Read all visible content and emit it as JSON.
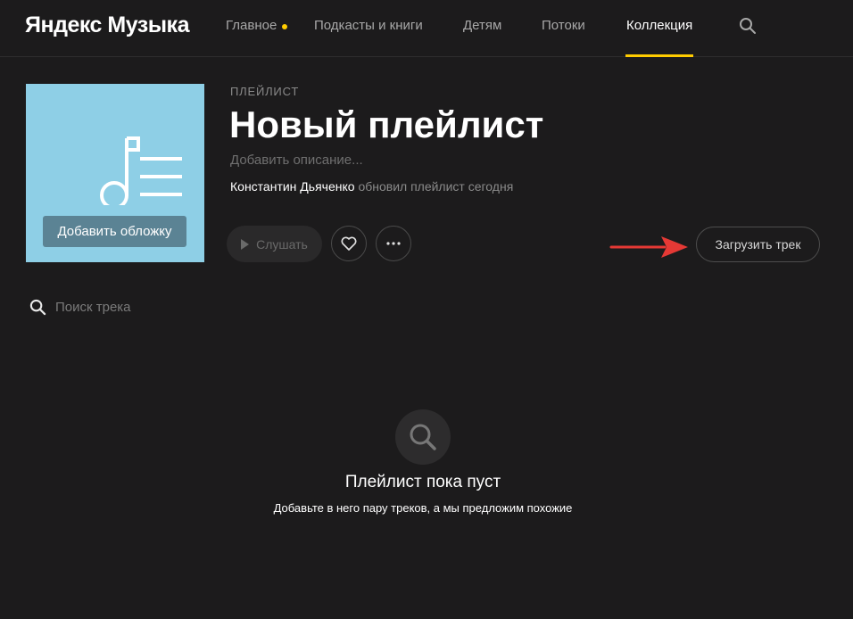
{
  "header": {
    "logo": "Яндекс Музыка",
    "nav": [
      {
        "label": "Главное"
      },
      {
        "label": "Подкасты и книги"
      },
      {
        "label": "Детям"
      },
      {
        "label": "Потоки"
      },
      {
        "label": "Коллекция"
      }
    ],
    "active_nav": "Коллекция",
    "accent_color": "#ffcc00"
  },
  "playlist": {
    "kind": "ПЛЕЙЛИСТ",
    "title": "Новый плейлист",
    "description_placeholder": "Добавить описание...",
    "owner": "Константин Дьяченко",
    "updated": "обновил плейлист сегодня",
    "cover": {
      "background_color": "#8ecfe6",
      "icon": "music-note-list-icon",
      "add_cover_label": "Добавить обложку"
    }
  },
  "actions": {
    "listen_label": "Слушать",
    "like_icon": "heart-icon",
    "more_icon": "more-dots-icon",
    "upload_label": "Загрузить трек"
  },
  "annotation": {
    "arrow_color": "#e53935"
  },
  "track_search": {
    "placeholder": "Поиск трека"
  },
  "empty_state": {
    "icon": "search-icon",
    "title": "Плейлист пока пуст",
    "subtitle": "Добавьте в него пару треков, а мы предложим похожие"
  }
}
